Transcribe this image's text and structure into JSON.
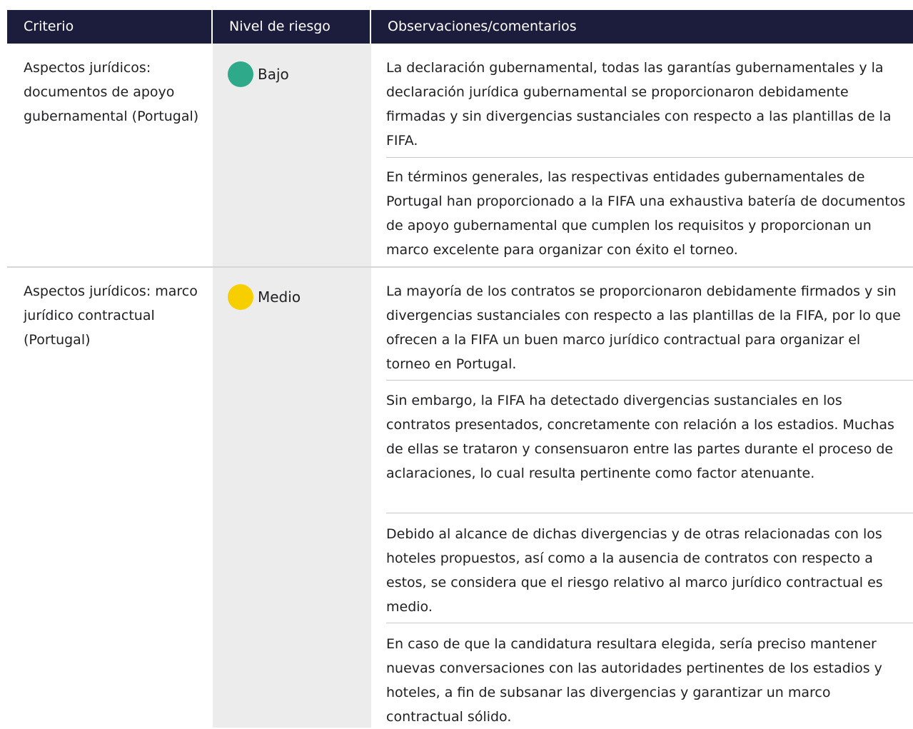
{
  "table": {
    "headers": {
      "criterio": "Criterio",
      "nivel": "Nivel de riesgo",
      "observaciones": "Observaciones/comentarios"
    },
    "rows": [
      {
        "criterio": "Aspectos jurídicos: documentos de apoyo gubernamental (Portugal)",
        "nivel": {
          "label": "Bajo",
          "color": "#2eaa8a"
        },
        "observaciones": [
          "La declaración gubernamental, todas las garantías gubernamentales y la declaración jurídica gubernamental se proporcionaron debidamente firmadas y sin divergencias sustanciales con respecto a las plantillas de la FIFA.",
          "En términos generales, las respectivas entidades gubernamentales de Portugal han proporcionado a la FIFA una exhaustiva batería de documentos de apoyo gubernamental que cumplen los requisitos y proporcionan un marco excelente para organizar con éxito el torneo."
        ]
      },
      {
        "criterio": "Aspectos jurídicos: marco jurídico contractual (Portugal)",
        "nivel": {
          "label": "Medio",
          "color": "#f7cf00"
        },
        "observaciones": [
          "La mayoría de los contratos se proporcionaron debidamente firmados y sin divergencias sustanciales con respecto a las plantillas de la FIFA, por lo que ofrecen a la FIFA un buen marco jurídico contractual para organizar el torneo en Portugal.",
          "Sin embargo, la FIFA ha detectado divergencias sustanciales en los contratos presentados, concretamente con relación a los estadios. Muchas de ellas se trataron y consensuaron entre las partes durante el proceso de aclaraciones, lo cual resulta pertinente como factor atenuante.",
          "Debido al alcance de dichas divergencias y de otras relacionadas con los hoteles propuestos, así como a la ausencia de contratos con respecto a estos, se considera que el riesgo relativo al marco jurídico contractual es medio.",
          "En caso de que la candidatura resultara elegida, sería preciso mantener nuevas conversaciones con las autoridades pertinentes de los estadios y hoteles, a fin de subsanar las divergencias y garantizar un marco contractual sólido."
        ]
      }
    ]
  }
}
